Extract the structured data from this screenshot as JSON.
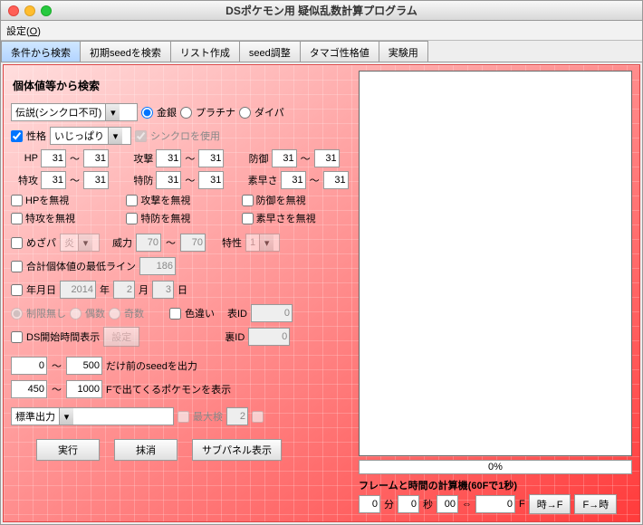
{
  "window": {
    "title": "DSポケモン用 疑似乱数計算プログラム"
  },
  "menu": {
    "settings": "設定(O)"
  },
  "tabs": [
    "条件から検索",
    "初期seedを検索",
    "リスト作成",
    "seed調整",
    "タマゴ性格値",
    "実験用"
  ],
  "active_tab": 0,
  "panel": {
    "heading": "個体値等から検索",
    "type_select": "伝説(シンクロ不可)",
    "game_options": {
      "gs": "金銀",
      "pt": "プラチナ",
      "dp": "ダイパ"
    },
    "nature_label": "性格",
    "nature_value": "いじっぱり",
    "synchro_label": "シンクロを使用",
    "stats": {
      "hp": {
        "label": "HP",
        "lo": "31",
        "hi": "31",
        "ignore": "HPを無視"
      },
      "atk": {
        "label": "攻撃",
        "lo": "31",
        "hi": "31",
        "ignore": "攻撃を無視"
      },
      "def": {
        "label": "防御",
        "lo": "31",
        "hi": "31",
        "ignore": "防御を無視"
      },
      "spa": {
        "label": "特攻",
        "lo": "31",
        "hi": "31",
        "ignore": "特攻を無視"
      },
      "spd": {
        "label": "特防",
        "lo": "31",
        "hi": "31",
        "ignore": "特防を無視"
      },
      "spe": {
        "label": "素早さ",
        "lo": "31",
        "hi": "31",
        "ignore": "素早さを無視"
      }
    },
    "hp_type": {
      "label": "めざパ",
      "value": "炎"
    },
    "hp_power": {
      "label": "威力",
      "lo": "70",
      "hi": "70"
    },
    "ability": {
      "label": "特性",
      "value": "1"
    },
    "min_iv_sum": {
      "label": "合計個体値の最低ライン",
      "value": "186"
    },
    "date": {
      "label": "年月日",
      "y": "2014",
      "ylabel": "年",
      "m": "2",
      "mlabel": "月",
      "d": "3",
      "dlabel": "日"
    },
    "parity": {
      "none": "制限無し",
      "even": "偶数",
      "odd": "奇数"
    },
    "shiny": {
      "label": "色違い",
      "tid_label": "表ID",
      "tid": "0",
      "sid_label": "裏ID",
      "sid": "0"
    },
    "ds_time": {
      "label": "DS開始時間表示",
      "button": "設定"
    },
    "seed_range": {
      "lo": "0",
      "hi": "500",
      "label": "だけ前のseedを出力"
    },
    "frame_range": {
      "lo": "450",
      "hi": "1000",
      "label": "Fで出てくるポケモンを表示"
    },
    "output_mode": "標準出力",
    "max_out": {
      "label": "最大検",
      "value": "2"
    },
    "buttons": {
      "run": "実行",
      "clear": "抹消",
      "subpanel": "サブパネル表示"
    }
  },
  "right": {
    "progress": "0%",
    "frame_calc_title": "フレームと時間の計算機(60Fで1秒)",
    "min_val": "0",
    "min_label": "分",
    "sec_val": "0",
    "sec_label": "秒",
    "sub_val": "00",
    "arrows": "⇔",
    "f_val": "0",
    "f_label": "F",
    "btn_time_to_f": "時→F",
    "btn_f_to_time": "F→時"
  }
}
